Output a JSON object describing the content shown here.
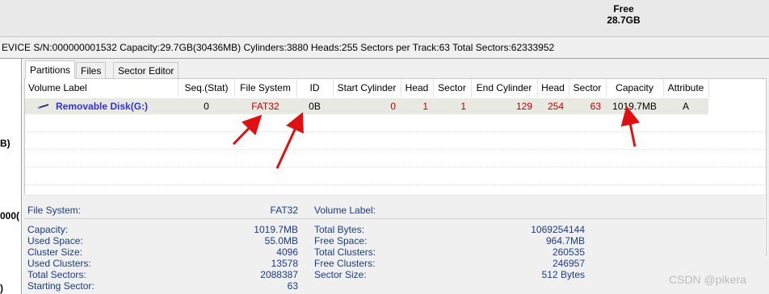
{
  "top": {
    "free_label": "Free",
    "free_value": "28.7GB"
  },
  "infobar": {
    "text": "EVICE  S/N:000000001532  Capacity:29.7GB(30436MB)  Cylinders:3880  Heads:255  Sectors per Track:63  Total Sectors:62333952"
  },
  "left_panel": {
    "fragments": [
      "B)",
      "000(",
      ")"
    ]
  },
  "tabs": [
    {
      "label": "Partitions"
    },
    {
      "label": "Files"
    },
    {
      "label": "Sector Editor"
    }
  ],
  "table": {
    "columns": [
      "Volume Label",
      "Seq.(Stat)",
      "File System",
      "ID",
      "Start Cylinder",
      "Head",
      "Sector",
      "End Cylinder",
      "Head",
      "Sector",
      "Capacity",
      "Attribute"
    ],
    "rows": [
      {
        "volume_label": "Removable Disk(G:)",
        "seq": "0",
        "file_system": "FAT32",
        "id": "0B",
        "start_cylinder": "0",
        "start_head": "1",
        "start_sector": "1",
        "end_cylinder": "129",
        "end_head": "254",
        "end_sector": "63",
        "capacity": "1019.7MB",
        "attribute": "A"
      }
    ]
  },
  "details": {
    "file_system_label": "File System:",
    "file_system_value": "FAT32",
    "volume_label_label": "Volume Label:",
    "volume_label_value": "",
    "left": [
      {
        "label": "Capacity:",
        "value": "1019.7MB"
      },
      {
        "label": "Used Space:",
        "value": "55.0MB"
      },
      {
        "label": "Cluster Size:",
        "value": "4096"
      },
      {
        "label": "Used Clusters:",
        "value": "13578"
      },
      {
        "label": "Total Sectors:",
        "value": "2088387"
      },
      {
        "label": "Starting Sector:",
        "value": "63"
      }
    ],
    "right": [
      {
        "label": "Total Bytes:",
        "value": "1069254144"
      },
      {
        "label": "Free Space:",
        "value": "964.7MB"
      },
      {
        "label": "Total Clusters:",
        "value": "260535"
      },
      {
        "label": "Free Clusters:",
        "value": "246957"
      },
      {
        "label": "Sector Size:",
        "value": "512 Bytes"
      }
    ]
  },
  "watermark": "CSDN @pikera",
  "colors": {
    "annotation_arrow": "#e01010",
    "volume_label": "#3333cc",
    "partition_values": "#c00000",
    "details_text": "#1a3a8a"
  }
}
